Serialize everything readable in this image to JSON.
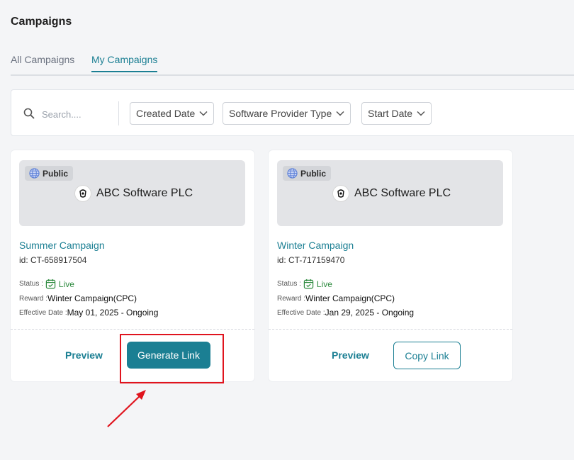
{
  "page": {
    "title": "Campaigns"
  },
  "tabs": [
    {
      "label": "All Campaigns",
      "active": false
    },
    {
      "label": "My Campaigns",
      "active": true
    }
  ],
  "filters": {
    "search_placeholder": "Search....",
    "dropdowns": [
      "Created Date",
      "Software Provider Type",
      "Start Date"
    ]
  },
  "campaigns": [
    {
      "visibility": "Public",
      "provider": "ABC Software PLC",
      "name": "Summer Campaign",
      "id": "id: CT-658917504",
      "status_label": "Status :",
      "status": "Live",
      "reward_label": "Reward :",
      "reward": "Winter Campaign(CPC)",
      "effective_label": "Effective Date :",
      "effective": "May 01, 2025 - Ongoing",
      "preview_label": "Preview",
      "action_label": "Generate Link"
    },
    {
      "visibility": "Public",
      "provider": "ABC Software PLC",
      "name": "Winter Campaign",
      "id": "id: CT-717159470",
      "status_label": "Status :",
      "status": "Live",
      "reward_label": "Reward :",
      "reward": "Winter Campaign(CPC)",
      "effective_label": "Effective Date :",
      "effective": "Jan 29, 2025 - Ongoing",
      "preview_label": "Preview",
      "action_label": "Copy Link"
    }
  ],
  "colors": {
    "accent": "#1b7f93",
    "live": "#2d8a3e",
    "highlight": "#e0141e"
  },
  "icons": [
    "search-icon",
    "chevron-down-icon",
    "globe-icon",
    "calendar-check-icon",
    "provider-logo-icon",
    "arrow-annotation"
  ]
}
